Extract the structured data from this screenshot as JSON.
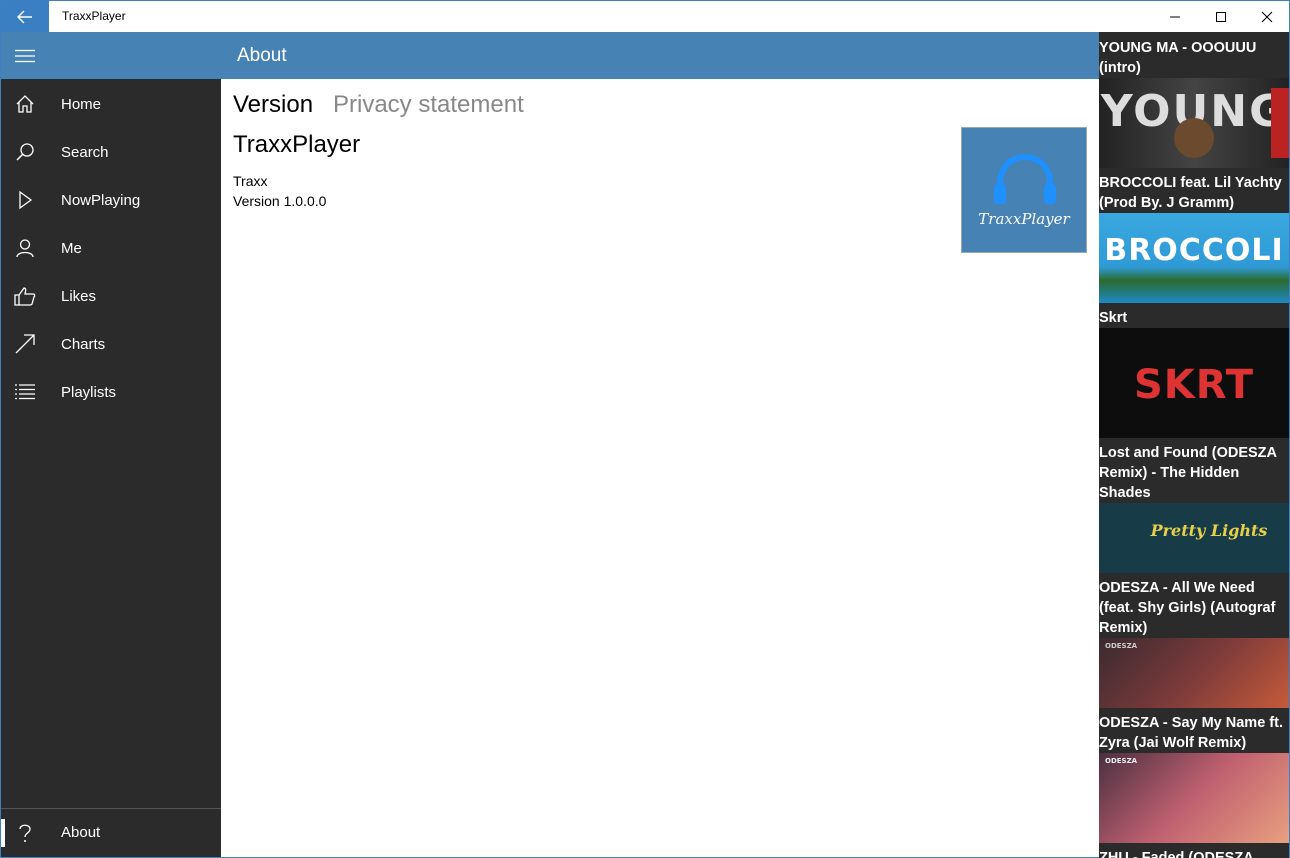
{
  "window": {
    "title": "TraxxPlayer"
  },
  "nav": {
    "items": [
      {
        "label": "Home",
        "icon": "home-icon"
      },
      {
        "label": "Search",
        "icon": "search-icon"
      },
      {
        "label": "NowPlaying",
        "icon": "play-icon"
      },
      {
        "label": "Me",
        "icon": "person-icon"
      },
      {
        "label": "Likes",
        "icon": "thumbs-up-icon"
      },
      {
        "label": "Charts",
        "icon": "trending-arrow-icon"
      },
      {
        "label": "Playlists",
        "icon": "list-icon"
      }
    ],
    "about": {
      "label": "About",
      "icon": "help-icon"
    }
  },
  "header": {
    "title": "About"
  },
  "pivot": {
    "version": "Version",
    "privacy": "Privacy statement"
  },
  "about": {
    "app_name": "TraxxPlayer",
    "publisher": "Traxx",
    "version": "Version 1.0.0.0",
    "logo_text": "TraxxPlayer"
  },
  "tracks": [
    {
      "title": "YOUNG MA - OOOUUU (intro)",
      "art_text": "YOUNG"
    },
    {
      "title": "BROCCOLI feat. Lil Yachty (Prod By. J Gramm)",
      "art_text": "BROCCOLI"
    },
    {
      "title": "Skrt",
      "art_text": "SKRT"
    },
    {
      "title": "Lost and Found (ODESZA Remix) - The Hidden Shades",
      "art_text": "Pretty Lights"
    },
    {
      "title": "ODESZA - All We Need (feat. Shy Girls) (Autograf Remix)",
      "art_text": "ODESZA"
    },
    {
      "title": "ODESZA - Say My Name ft. Zyra (Jai Wolf Remix)",
      "art_text": "ODESZA"
    },
    {
      "title": "ZHU - Faded (ODESZA",
      "art_text": ""
    }
  ],
  "colors": {
    "accent": "#4682b4",
    "sidebar": "#2b2b2b",
    "back_button": "#3a7fc1"
  }
}
